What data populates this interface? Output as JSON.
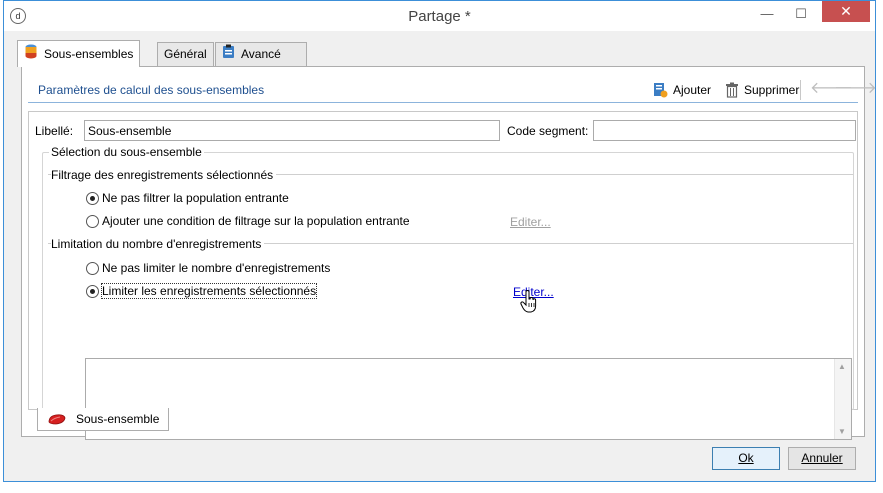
{
  "window": {
    "title": "Partage *",
    "app_icon": "logo-icon"
  },
  "titlebar_buttons": {
    "minimize": "—",
    "maximize": "☐",
    "close": "✕"
  },
  "tabs": [
    {
      "label": "Sous-ensembles",
      "icon": "database-icon",
      "active": true
    },
    {
      "label": "Général",
      "icon": "",
      "active": false
    },
    {
      "label": "Avancé",
      "icon": "clipboard-icon",
      "active": false
    }
  ],
  "section": {
    "title": "Paramètres de calcul des sous-ensembles",
    "add_label": "Ajouter",
    "delete_label": "Supprimer",
    "prev_arrow": "🡐",
    "next_arrow": "🡒"
  },
  "form": {
    "libelle_label": "Libellé:",
    "libelle_value": "Sous-ensemble",
    "code_segment_label": "Code segment:",
    "code_segment_value": ""
  },
  "selection_group": {
    "title": "Sélection du sous-ensemble",
    "filtering": {
      "title": "Filtrage des enregistrements sélectionnés",
      "options": [
        {
          "label": "Ne pas filtrer la population entrante",
          "checked": true
        },
        {
          "label": "Ajouter une condition de filtrage sur la population entrante",
          "checked": false
        }
      ],
      "edit_link": "Editer..."
    },
    "limitation": {
      "title": "Limitation du nombre d'enregistrements",
      "options": [
        {
          "label": "Ne pas limiter le nombre d'enregistrements",
          "checked": false
        },
        {
          "label": "Limiter les enregistrements sélectionnés",
          "checked": true
        }
      ],
      "edit_link": "Editer..."
    },
    "textarea_value": ""
  },
  "bottom_tab": {
    "label": "Sous-ensemble",
    "icon": "subset-icon"
  },
  "buttons": {
    "ok_label": "Ok",
    "cancel_label": "Annuler"
  },
  "colors": {
    "accent": "#1e4f8f",
    "close": "#c75050",
    "link": "#0000cc",
    "window_border": "#3c8fd8"
  }
}
